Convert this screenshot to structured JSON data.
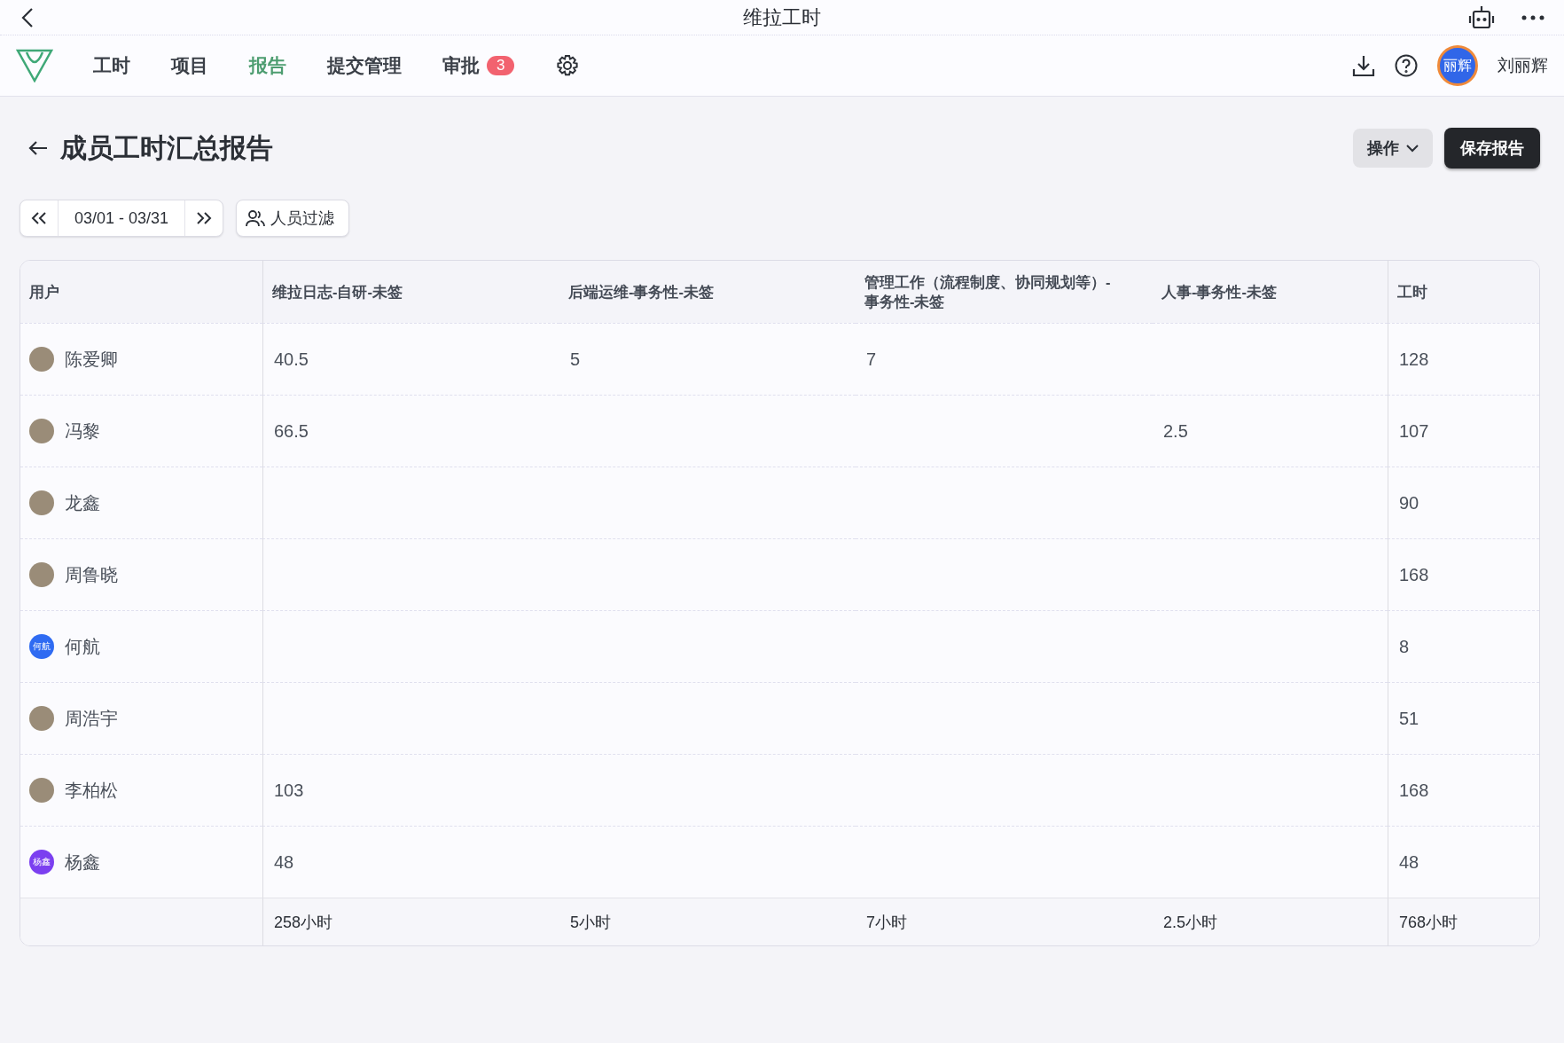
{
  "window": {
    "title": "维拉工时"
  },
  "nav": {
    "tabs": [
      {
        "label": "工时",
        "selected": false
      },
      {
        "label": "项目",
        "selected": false
      },
      {
        "label": "报告",
        "selected": true
      },
      {
        "label": "提交管理",
        "selected": false
      },
      {
        "label": "审批",
        "selected": false,
        "badge": "3"
      }
    ],
    "user": {
      "avatar_text": "丽辉",
      "name": "刘丽辉"
    }
  },
  "page": {
    "title": "成员工时汇总报告",
    "actions_menu": "操作",
    "save_button": "保存报告"
  },
  "filters": {
    "date_range": "03/01 - 03/31",
    "people_filter": "人员过滤"
  },
  "table": {
    "columns": [
      "用户",
      "维拉日志-自研-未签",
      "后端运维-事务性-未签",
      "管理工作（流程制度、协同规划等）-事务性-未签",
      "人事-事务性-未签",
      "工时"
    ],
    "rows": [
      {
        "avatar": {
          "kind": "photo"
        },
        "cells": [
          "陈爱卿",
          "40.5",
          "5",
          "7",
          "",
          "128"
        ]
      },
      {
        "avatar": {
          "kind": "photo"
        },
        "cells": [
          "冯黎",
          "66.5",
          "",
          "",
          "2.5",
          "107"
        ]
      },
      {
        "avatar": {
          "kind": "photo"
        },
        "cells": [
          "龙鑫",
          "",
          "",
          "",
          "",
          "90"
        ]
      },
      {
        "avatar": {
          "kind": "photo"
        },
        "cells": [
          "周鲁晓",
          "",
          "",
          "",
          "",
          "168"
        ]
      },
      {
        "avatar": {
          "kind": "text",
          "text": "何航",
          "color": "#2f6bf2"
        },
        "cells": [
          "何航",
          "",
          "",
          "",
          "",
          "8"
        ]
      },
      {
        "avatar": {
          "kind": "photo"
        },
        "cells": [
          "周浩宇",
          "",
          "",
          "",
          "",
          "51"
        ]
      },
      {
        "avatar": {
          "kind": "photo"
        },
        "cells": [
          "李柏松",
          "103",
          "",
          "",
          "",
          "168"
        ]
      },
      {
        "avatar": {
          "kind": "text",
          "text": "杨鑫",
          "color": "#7b3ff0"
        },
        "cells": [
          "杨鑫",
          "48",
          "",
          "",
          "",
          "48"
        ]
      }
    ],
    "footer": [
      "258小时",
      "5小时",
      "7小时",
      "2.5小时",
      "768小时"
    ]
  }
}
